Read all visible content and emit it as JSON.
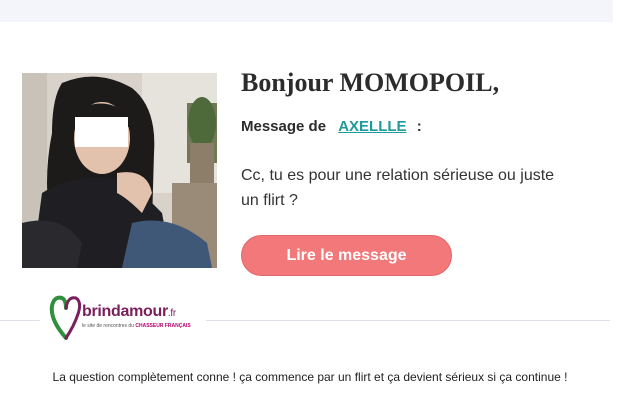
{
  "email": {
    "greeting": "Bonjour MOMOPOIL,",
    "from_prefix": "Message de",
    "sender_name": "AXELLLE",
    "from_suffix": ":",
    "message_text": "Cc, tu es pour une relation sérieuse ou juste un flirt ?",
    "cta_label": "Lire le message"
  },
  "logo": {
    "name": "brindamour",
    "tld": ".fr",
    "tagline_prefix": "le site de rencontres du",
    "tagline_brand": "CHASSEUR FRANÇAIS"
  },
  "caption": "La question complètement conne ! ça commence par un flirt et ça devient sérieux si ça continue !",
  "colors": {
    "accent_button": "#f2787a",
    "sender_link": "#1f9a9a",
    "logo_purple": "#7a1e5c",
    "logo_green": "#2f8f3a"
  }
}
